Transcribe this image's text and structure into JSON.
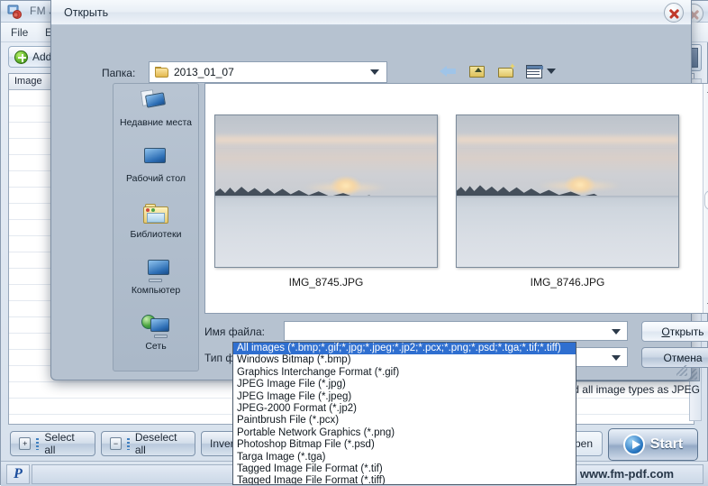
{
  "app": {
    "title": "FM JP",
    "icon": "app-logo-icon",
    "close_label": "✕",
    "menu": [
      {
        "label": "File"
      },
      {
        "label": "Ed"
      }
    ],
    "toolbar": {
      "add_label": "Add"
    },
    "grid": {
      "columns": [
        "Image"
      ],
      "rows": []
    },
    "bottom_buttons": [
      {
        "label": "Select all",
        "icon": "plus-box-icon"
      },
      {
        "label": "Deselect all",
        "icon": "minus-box-icon"
      },
      {
        "label": "Inverse sel",
        "icon": "inverse-box-icon"
      }
    ],
    "open_button_label": "Open",
    "start_button_label": "Start",
    "convert_note": "d all image types as JPEG",
    "statusbar": {
      "paypal_mark": "P",
      "status_text": "",
      "site": "www.fm-pdf.com"
    }
  },
  "dialog": {
    "title": "Открыть",
    "close_label": "✕",
    "folder_label": "Папка:",
    "folder_value": "2013_01_07",
    "toolbar_icons": [
      {
        "name": "back-arrow-icon"
      },
      {
        "name": "folder-up-icon"
      },
      {
        "name": "new-folder-icon"
      },
      {
        "name": "view-mode-icon"
      }
    ],
    "places": [
      {
        "label": "Недавние места",
        "icon": "recent-places-icon"
      },
      {
        "label": "Рабочий стол",
        "icon": "desktop-icon"
      },
      {
        "label": "Библиотеки",
        "icon": "libraries-icon"
      },
      {
        "label": "Компьютер",
        "icon": "computer-icon"
      },
      {
        "label": "Сеть",
        "icon": "network-icon"
      }
    ],
    "files": [
      {
        "name": "IMG_8745.JPG",
        "type": "thumbnail"
      },
      {
        "name": "IMG_8746.JPG",
        "type": "thumbnail"
      }
    ],
    "filename_label": "Имя файла:",
    "filename_value": "",
    "filetype_label": "Тип файлов:",
    "filetype_value": "All images (*.bmp;*.gif;*.jpg;*.jpeg;*.jp2;*.pcx;*.png;*.psd;*.tga;*.tif;*.tiff)",
    "open_label_prefix": "О",
    "open_label_rest": "ткрыть",
    "cancel_label": "Отмена",
    "filetype_options": [
      "All images (*.bmp;*.gif;*.jpg;*.jpeg;*.jp2;*.pcx;*.png;*.psd;*.tga;*.tif;*.tiff)",
      "Windows Bitmap (*.bmp)",
      "Graphics Interchange Format (*.gif)",
      "JPEG Image File (*.jpg)",
      "JPEG Image File (*.jpeg)",
      "JPEG-2000 Format (*.jp2)",
      "Paintbrush File (*.pcx)",
      "Portable Network Graphics (*.png)",
      "Photoshop Bitmap File (*.psd)",
      "Targa Image (*.tga)",
      "Tagged Image File Format (*.tif)",
      "Tagged Image File Format (*.tiff)"
    ],
    "selected_option_index": 0
  },
  "colors": {
    "accent": "#2f6fd0",
    "dialog_bg": "#b6c2d0",
    "app_bg": "#d6e0ec",
    "close_x": "#c0392b"
  }
}
